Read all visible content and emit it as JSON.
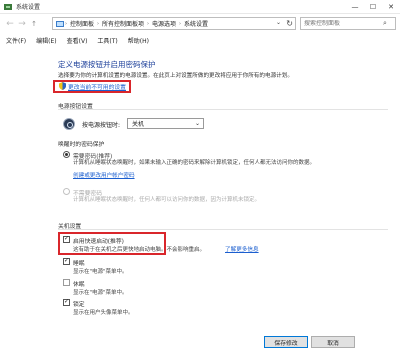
{
  "window": {
    "title": "系统设置",
    "icons": {
      "app": "power-options-icon",
      "min": "minimize-icon",
      "max": "maximize-icon",
      "close": "close-icon"
    }
  },
  "address": {
    "crumbs": [
      "控制面板",
      "所有控制面板项",
      "电源选项",
      "系统设置"
    ],
    "search_placeholder": "搜索控制面板"
  },
  "menu": [
    "文件(F)",
    "编辑(E)",
    "查看(V)",
    "工具(T)",
    "帮助(H)"
  ],
  "page": {
    "heading": "定义电源按钮并启用密码保护",
    "description": "选择要为你的计算机设置的电源设置。在此页上对设置所做的更改将应用于你所有的电源计划。",
    "change_link": "更改当前不可用的设置"
  },
  "power_button": {
    "section": "电源按钮设置",
    "label": "按电源按钮时:",
    "selected": "关机"
  },
  "wake_password": {
    "section": "唤醒时的密码保护",
    "require": {
      "label": "需要密码(推荐)",
      "desc": "计算机从睡眠状态唤醒时，如果未输入正确的密码来解除计算机锁定，任何人都无法访问你的数据。",
      "link": "创建或更改用户帐户密码"
    },
    "no_require": {
      "label": "不需要密码",
      "desc": "计算机从睡眠状态唤醒时，任何人都可以访问你的数据，因为计算机未锁定。"
    }
  },
  "shutdown": {
    "section": "关机设置",
    "fast_startup": {
      "label": "启用快速启动(推荐)",
      "desc": "这有助于在关机之后更快地启动电脑。不会影响重启。",
      "link": "了解更多信息"
    },
    "sleep": {
      "label": "睡眠",
      "desc": "显示在\"电源\"菜单中。"
    },
    "hibernate": {
      "label": "休眠",
      "desc": "显示在\"电源\"菜单中。"
    },
    "lock": {
      "label": "锁定",
      "desc": "显示在用户头像菜单中。"
    }
  },
  "buttons": {
    "save": "保存修改",
    "cancel": "取消"
  },
  "colors": {
    "accent": "#1c3f9a",
    "link": "#1b5ecf",
    "highlight_box": "#d9262b"
  }
}
